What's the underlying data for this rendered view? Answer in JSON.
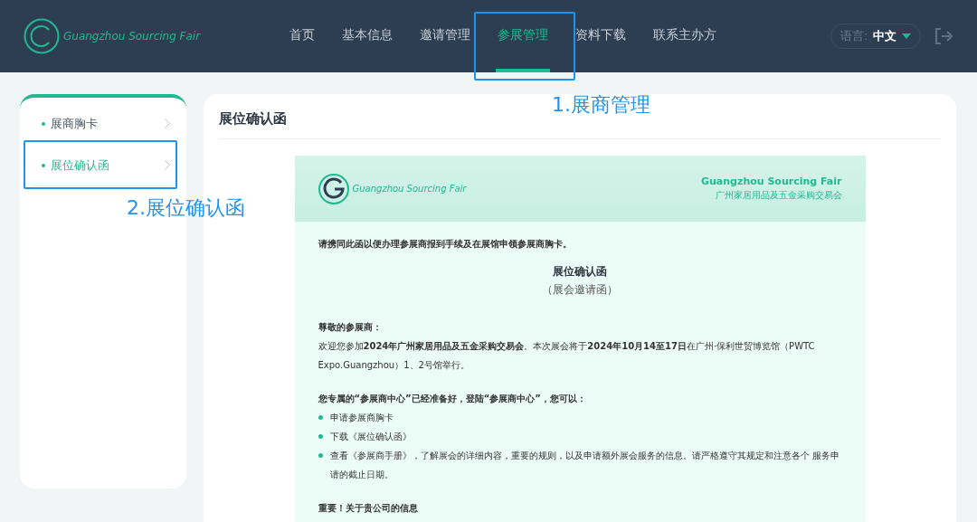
{
  "header": {
    "logo_text": "Guangzhou Sourcing Fair",
    "nav": [
      {
        "label": "首页",
        "selected": false
      },
      {
        "label": "基本信息",
        "selected": false
      },
      {
        "label": "邀请管理",
        "selected": false
      },
      {
        "label": "参展管理",
        "selected": true
      },
      {
        "label": "资料下载",
        "selected": false
      },
      {
        "label": "联系主办方",
        "selected": false
      }
    ],
    "language": {
      "label": "语言:",
      "value": "中文"
    }
  },
  "sidebar": {
    "items": [
      {
        "label": "展商胸卡",
        "selected": false
      },
      {
        "label": "展位确认函",
        "selected": true
      }
    ]
  },
  "main": {
    "title": "展位确认函",
    "letter": {
      "logo_text": "Guangzhou Sourcing Fair",
      "name_en": "Guangzhou Sourcing Fair",
      "name_zh": "广州家居用品及五金采购交易会",
      "intro": "请携同此函以便办理参展商报到手续及在展馆申领参展商胸卡。",
      "title": "展位确认函",
      "subtitle": "（展会邀请函）",
      "greeting": "尊敬的参展商：",
      "welcome": "欢迎您参加**2024年广州家居用品及五金采购交易会**。本次展会将于**2024年10月14至17日**在广州·保利世贸博览馆（PWTC Expo.Guangzhou）1、2号馆举行。",
      "center_intro": "您专属的“参展商中心”已经准备好，登陆“参展商中心”，您可以：",
      "bullets": [
        "申请参展商胸卡",
        "下载《展位确认函》",
        "查看《参展商手册》，了解展会的详细内容，重要的规则，以及申请额外展会服务的信息。请严格遵守其规定和注意各个  服务申请的截止日期。"
      ],
      "section_heading": "重要！关于贵公司的信息"
    }
  },
  "annotations": [
    {
      "kind": "nav",
      "label": "1.展商管理"
    },
    {
      "kind": "sidebar",
      "label": "2.展位确认函"
    }
  ]
}
